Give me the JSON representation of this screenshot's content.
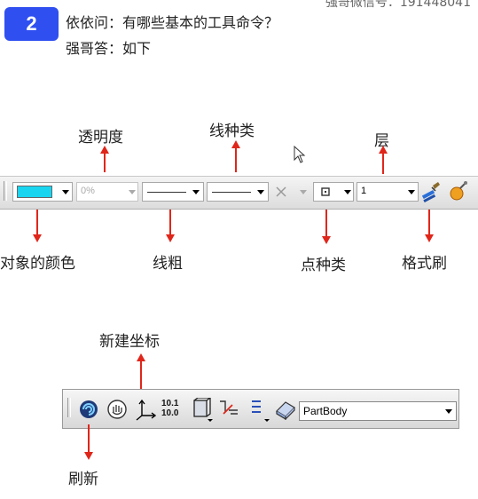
{
  "header": {
    "number": "2",
    "question": "依依问：有哪些基本的工具命令？",
    "answer": "强哥答：如下",
    "watermark": "强哥微信号：191448041"
  },
  "labels": {
    "transparency": "透明度",
    "line_type": "线种类",
    "layer": "层",
    "object_color": "对象的颜色",
    "line_width": "线粗",
    "point_type": "点种类",
    "format_painter": "格式刷",
    "new_axis": "新建坐标",
    "refresh": "刷新"
  },
  "toolbar1": {
    "color_value": "#19d5f0",
    "transparency_value": "0%",
    "layer_value": "1"
  },
  "toolbar2": {
    "body_select_value": "PartBody",
    "axis_icon_text_top": "10.1",
    "axis_icon_text_bottom": "10.0"
  },
  "colors": {
    "badge": "#2f4ff0",
    "arrow": "#e0261a",
    "swatch": "#19d5f0"
  }
}
